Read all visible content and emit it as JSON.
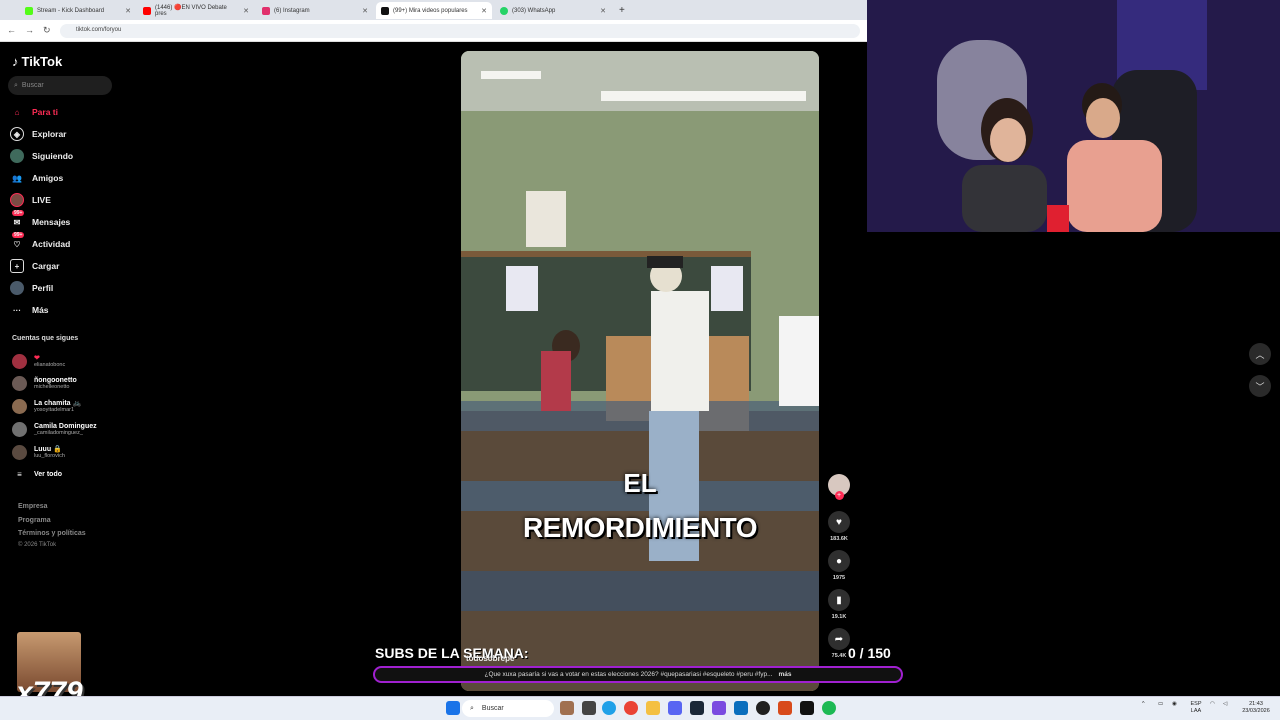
{
  "browser": {
    "tabs": [
      {
        "title": "Stream - Kick Dashboard",
        "color": "#53fc18",
        "active": false
      },
      {
        "title": "(1446) 🔴EN VIVO Debate pres",
        "color": "#ff0000",
        "active": false
      },
      {
        "title": "(6) Instagram",
        "color": "#e1306c",
        "active": false
      },
      {
        "title": "(99+) Mira videos populares",
        "color": "#111111",
        "active": true
      },
      {
        "title": "(303) WhatsApp",
        "color": "#25d366",
        "active": false
      }
    ],
    "new_tab": "+",
    "url": "tiktok.com/foryou"
  },
  "tiktok": {
    "logo": "TikTok",
    "search_placeholder": "Buscar",
    "nav": [
      {
        "label": "Para ti",
        "icon": "home-icon",
        "active": true
      },
      {
        "label": "Explorar",
        "icon": "compass-icon",
        "active": false
      },
      {
        "label": "Siguiendo",
        "icon": "following-icon",
        "active": false
      },
      {
        "label": "Amigos",
        "icon": "friends-icon",
        "active": false
      },
      {
        "label": "LIVE",
        "icon": "live-icon",
        "active": false
      },
      {
        "label": "Mensajes",
        "icon": "messages-icon",
        "badge": "99+",
        "active": false
      },
      {
        "label": "Actividad",
        "icon": "activity-icon",
        "badge": "99+",
        "active": false
      },
      {
        "label": "Cargar",
        "icon": "upload-icon",
        "active": false
      },
      {
        "label": "Perfil",
        "icon": "profile-icon",
        "active": false
      },
      {
        "label": "Más",
        "icon": "more-icon",
        "active": false
      }
    ],
    "following_title": "Cuentas que sigues",
    "following": [
      {
        "name": "❤",
        "handle": "elianatobonc"
      },
      {
        "name": "ñongoonetto",
        "handle": "michelleonetto"
      },
      {
        "name": "La chamita 🚲",
        "handle": "yosoyitadelmar1"
      },
      {
        "name": "Camila Dominguez",
        "handle": "_camiladominguez_"
      },
      {
        "name": "Luuu 🔒",
        "handle": "luu_florovich"
      }
    ],
    "see_all": "Ver todo",
    "footer": [
      "Empresa",
      "Programa",
      "Términos y políticas",
      "© 2026 TikTok"
    ],
    "video": {
      "caption_line1": "EL",
      "caption_line2": "REMORDIMIENTO",
      "description": "¿Que xuxa pasaría si vas a votar en estas elecciones 2026? #quepasariasi #esqueleto #peru #fyp...",
      "more": "más"
    },
    "actions": {
      "likes": "183.6K",
      "comments": "1975",
      "saves": "19.1K",
      "shares": "75.4K"
    }
  },
  "overlay": {
    "subs_label": "SUBS DE LA SEMANA:",
    "sub_name": "todosobrepe",
    "counter": "0  / 150",
    "multiplier": "x779"
  },
  "taskbar": {
    "search": "Buscar",
    "lang": "ESP",
    "lang2": "LAA",
    "time": "21:43",
    "date": "23/03/2026"
  }
}
